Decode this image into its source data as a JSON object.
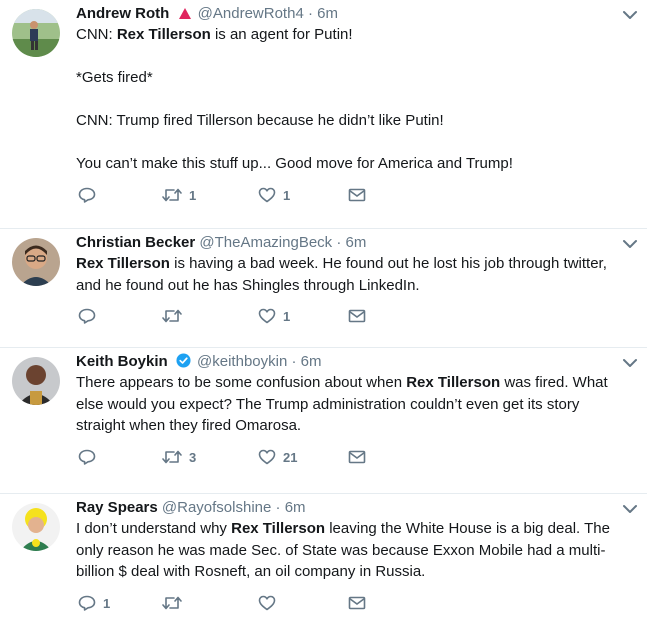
{
  "tweets": [
    {
      "name": "Andrew Roth",
      "handle": "@AndrewRoth4",
      "dot": "·",
      "time": "6m",
      "badge": "red-triangle",
      "text": [
        [
          {
            "t": "CNN: "
          },
          {
            "t": "Rex Tillerson",
            "b": true
          },
          {
            "t": " is an agent for Putin!"
          }
        ],
        [],
        [
          {
            "t": "*Gets fired*"
          }
        ],
        [],
        [
          {
            "t": "CNN: Trump fired Tillerson because he didn’t like Putin!"
          }
        ],
        [],
        [
          {
            "t": "You can’t make this stuff up... Good move for America and Trump!"
          }
        ]
      ],
      "reply_count": "",
      "retweet_count": "1",
      "like_count": "1"
    },
    {
      "name": "Christian Becker",
      "handle": "@TheAmazingBeck",
      "dot": "·",
      "time": "6m",
      "badge": "",
      "text": [
        [
          {
            "t": "Rex Tillerson",
            "b": true
          },
          {
            "t": " is having a bad week. He found out he lost his job through twitter,"
          }
        ],
        [
          {
            "t": "and he found out he has Shingles through LinkedIn."
          }
        ]
      ],
      "reply_count": "",
      "retweet_count": "",
      "like_count": "1"
    },
    {
      "name": "Keith Boykin",
      "handle": "@keithboykin",
      "dot": "·",
      "time": "6m",
      "badge": "verified",
      "text": [
        [
          {
            "t": "There appears to be some confusion about when "
          },
          {
            "t": "Rex Tillerson",
            "b": true
          },
          {
            "t": " was fired. What"
          }
        ],
        [
          {
            "t": "else would you expect? The Trump administration couldn’t even get its story"
          }
        ],
        [
          {
            "t": "straight when they fired Omarosa."
          }
        ]
      ],
      "reply_count": "",
      "retweet_count": "3",
      "like_count": "21"
    },
    {
      "name": "Ray Spears",
      "handle": "@Rayofsolshine",
      "dot": "·",
      "time": "6m",
      "badge": "",
      "text": [
        [
          {
            "t": "I don’t understand why "
          },
          {
            "t": "Rex Tillerson",
            "b": true
          },
          {
            "t": " leaving the White House is a big deal. The"
          }
        ],
        [
          {
            "t": "only reason he was made Sec. of State was because Exxon Mobile had a multi-"
          }
        ],
        [
          {
            "t": "billion $ deal with Rosneft, an oil company in Russia."
          }
        ]
      ],
      "reply_count": "1",
      "retweet_count": "",
      "like_count": ""
    }
  ],
  "colors": {
    "text": "#14171a",
    "secondary": "#657786",
    "divider": "#e6ecf0",
    "verified": "#1da1f2",
    "red_badge": "#e0245e"
  },
  "icons": {
    "reply": "reply-icon",
    "retweet": "retweet-icon",
    "like": "heart-icon",
    "message": "envelope-icon",
    "caret": "chevron-down-icon"
  }
}
